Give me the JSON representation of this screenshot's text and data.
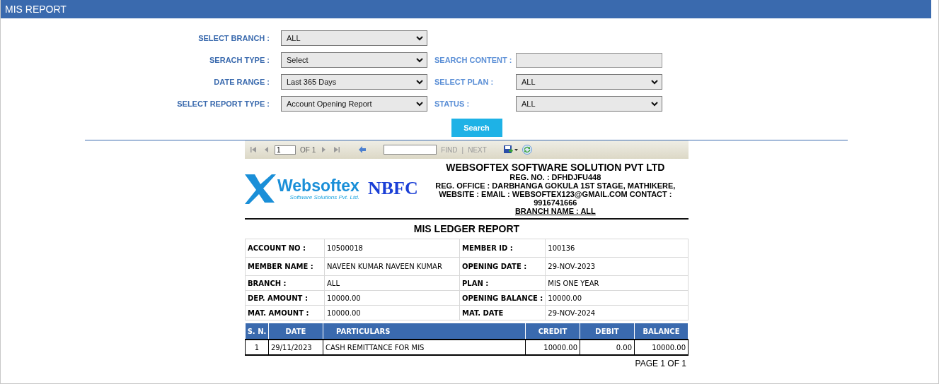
{
  "header": {
    "title": "MIS REPORT"
  },
  "filters": [
    [
      {
        "label": "SELECT BRANCH :",
        "kind": "select",
        "value": "ALL"
      }
    ],
    [
      {
        "label": "SERACH TYPE :",
        "kind": "select",
        "value": "Select"
      },
      {
        "label": "SEARCH CONTENT :",
        "kind": "input"
      }
    ],
    [
      {
        "label": "DATE RANGE :",
        "kind": "select",
        "value": "Last 365 Days"
      },
      {
        "label": "SELECT PLAN :",
        "kind": "select",
        "value": "ALL"
      }
    ],
    [
      {
        "label": "SELECT REPORT TYPE :",
        "kind": "select",
        "value": "Account Opening Report"
      },
      {
        "label": "STATUS :",
        "kind": "select",
        "value": "ALL"
      }
    ]
  ],
  "search_button": "Search",
  "viewer_toolbar": {
    "page": "1",
    "page_of": "OF 1",
    "find": "FIND",
    "separator": "|",
    "next": "NEXT"
  },
  "report": {
    "logo_name": "Websoftex",
    "logo_tagline": "Software Solutions Pvt. Ltd.",
    "badge": "NBFC",
    "company": "WEBSOFTEX SOFTWARE SOLUTION PVT LTD",
    "reg_no": "REG. NO. : DFHDJFU448",
    "reg_office": "REG. OFFICE : DARBHANGA  GOKULA 1ST STAGE, MATHIKERE,",
    "contact": "WEBSITE :       EMAIL : WEBSOFTEX123@GMAIL.COM    CONTACT : 9916741666",
    "branch_name": "BRANCH NAME : ALL",
    "title": "MIS LEDGER REPORT",
    "details": [
      [
        "ACCOUNT NO :",
        "10500018",
        "MEMBER ID :",
        "100136"
      ],
      [
        "MEMBER NAME :",
        "NAVEEN KUMAR NAVEEN KUMAR",
        "OPENING DATE :",
        "29-NOV-2023"
      ],
      [
        "BRANCH :",
        "ALL",
        "PLAN :",
        "MIS ONE YEAR"
      ],
      [
        "DEP. AMOUNT :",
        "10000.00",
        "OPENING BALANCE :",
        "10000.00"
      ],
      [
        "MAT. AMOUNT :",
        "10000.00",
        "MAT. DATE",
        "29-NOV-2024"
      ]
    ],
    "ledger": {
      "columns": [
        "S. N.",
        "DATE",
        "PARTICULARS",
        "CREDIT",
        "DEBIT",
        "BALANCE"
      ],
      "rows": [
        [
          "1",
          "29/11/2023",
          "CASH REMITTANCE FOR MIS",
          "10000.00",
          "0.00",
          "10000.00"
        ]
      ]
    },
    "footer": "PAGE 1 OF 1"
  }
}
